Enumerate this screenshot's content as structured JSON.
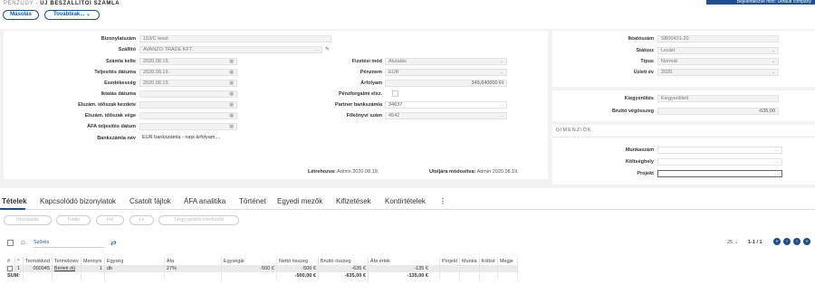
{
  "header": {
    "breadcrumb": "PÉNZÜGY",
    "separator": " - ",
    "title": "ÚJ BESZÁLLÍTÓI SZÁMLA",
    "top_right": "Bejelentkezve mint: Default company"
  },
  "actions": {
    "copy": "Másolás",
    "more": "Továbbiak..."
  },
  "form": {
    "document_number": {
      "label": "Bizonylatszám",
      "value": "153/C teszt"
    },
    "supplier": {
      "label": "Szállító",
      "value": "AVANZO-TRADE KFT."
    },
    "issue_date": {
      "label": "Számla kelte",
      "value": "2020.08.19."
    },
    "fulfillment_date": {
      "label": "Teljesítés dátuma",
      "value": "2020.08.19."
    },
    "due_date": {
      "label": "Esedékesség",
      "value": "2020.08.19."
    },
    "filing_date": {
      "label": "Iktatás dátuma",
      "value": ""
    },
    "period_start": {
      "label": "Elszám. időszak kezdete",
      "value": ""
    },
    "period_end": {
      "label": "Elszám. időszak vége",
      "value": ""
    },
    "vat_date": {
      "label": "ÁFA teljesítés dátum",
      "value": ""
    },
    "bank_account_name": {
      "label": "Bankszámla név",
      "value": "EUR bankszámla - napi árfolyam,..."
    },
    "payment_method": {
      "label": "Fizetési mód",
      "value": "Átutalás"
    },
    "currency": {
      "label": "Pénznem",
      "value": "EUR"
    },
    "exchange_rate": {
      "label": "Árfolyam",
      "value": "349,640000 Ft"
    },
    "cash_accounting": {
      "label": "Pénzforgalmi elsz."
    },
    "partner_bank": {
      "label": "Partner bankszámla",
      "value": "34637"
    },
    "ledger_number": {
      "label": "Főkönyvi szám",
      "value": "4542"
    },
    "created": {
      "label": "Létrehozva:",
      "value": "Admin 2020.08.19."
    },
    "modified": {
      "label": "Utoljára módosítva:",
      "value": "Admin 2020.08.19."
    }
  },
  "right": {
    "filing_number": {
      "label": "Iktatószám",
      "value": "SB00431-20"
    },
    "status": {
      "label": "Státusz",
      "value": "Lezárt"
    },
    "type": {
      "label": "Típus",
      "value": "Normál"
    },
    "fiscal_year": {
      "label": "Üzleti év",
      "value": "2020"
    },
    "settlement": {
      "label": "Kiegyenlítés",
      "value": "Kiegyenlített"
    },
    "gross_final": {
      "label": "Bruttó végösszeg",
      "value": "-635,00"
    },
    "dimensions_title": "DIMENZIÓK",
    "worksite": {
      "label": "Munkaszám",
      "value": ""
    },
    "cost_center": {
      "label": "Költséghely",
      "value": ""
    },
    "project": {
      "label": "Projekt",
      "value": ""
    }
  },
  "tabs": [
    "Tételek",
    "Kapcsolódó bizonylatok",
    "Csatolt fájlok",
    "ÁFA analitika",
    "Történet",
    "Egyedi mezők",
    "Kifizetések",
    "Kontírtételek"
  ],
  "item_actions": [
    "Hozzáadás",
    "Törlés",
    "Fel",
    "Le",
    "Tárgyi eszköz létrehozás"
  ],
  "filter": {
    "label": "Szűrés",
    "page_size": "25",
    "page_info": "1-1 / 1"
  },
  "table": {
    "headers": [
      "#",
      "^",
      "Termékkód",
      "Terméknév",
      "Mennyis",
      "Egység",
      "Áfa",
      "Egységár",
      "Nettó összeg",
      "Bruttó összeg",
      "Áfa érték",
      "Projekt",
      "Munka",
      "Költsé",
      "Megje"
    ],
    "row": {
      "num": "1",
      "code": "000045",
      "name": "Bérleti díj",
      "qty": "1",
      "unit": "db",
      "vat": "27%",
      "unit_price": "-500 €",
      "net": "-500 €",
      "gross": "-635 €",
      "vat_value": "-135 €"
    },
    "sum": {
      "label": "SUM:",
      "net": "-500,00 €",
      "gross": "-635,00 €",
      "vat_value": "-135,00 €"
    }
  }
}
